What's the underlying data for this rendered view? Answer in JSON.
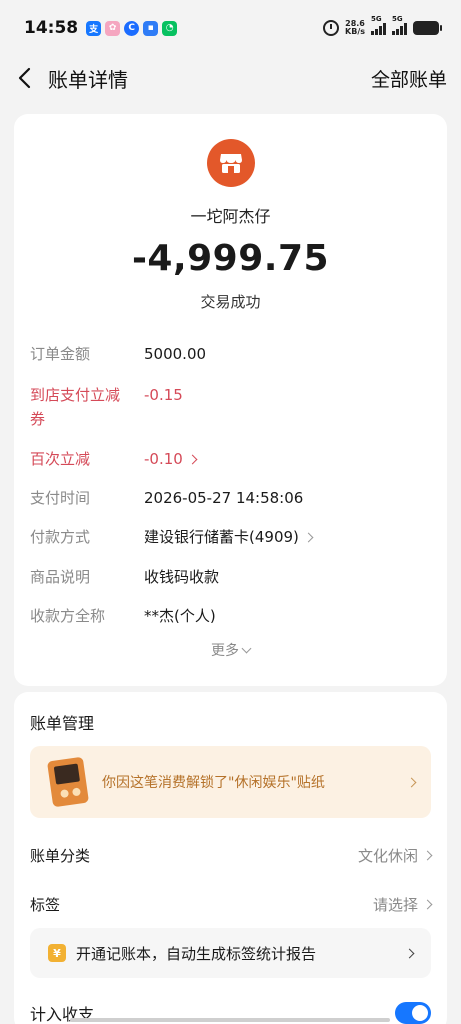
{
  "status_bar": {
    "time": "14:58",
    "net_speed_value": "28.6",
    "net_speed_unit": "KB/s",
    "signal1": "5G",
    "signal2": "5G",
    "apps": [
      {
        "name": "alipay-icon",
        "glyph": "支",
        "color": "#1677ff"
      },
      {
        "name": "pink-app-icon",
        "glyph": "✿",
        "color": "#f5a6c0"
      },
      {
        "name": "c-app-icon",
        "glyph": "C",
        "color": "#1b6cff"
      },
      {
        "name": "chat-app-icon",
        "glyph": "▪",
        "color": "#2f7cf6"
      },
      {
        "name": "wechat-icon",
        "glyph": "◔",
        "color": "#07c160"
      }
    ]
  },
  "nav": {
    "title": "账单详情",
    "right_action": "全部账单"
  },
  "detail": {
    "merchant_name": "一坨阿杰仔",
    "amount": "-4,999.75",
    "status": "交易成功",
    "rows": [
      {
        "label": "订单金额",
        "value": "5000.00"
      },
      {
        "label_line1": "到店支付立减",
        "label_line2": "券",
        "value": "-0.15"
      },
      {
        "label": "百次立减",
        "value": "-0.10"
      },
      {
        "label": "支付时间",
        "value": "2026-05-27 14:58:06"
      },
      {
        "label": "付款方式",
        "value": "建设银行储蓄卡(4909)"
      },
      {
        "label": "商品说明",
        "value": "收钱码收款"
      },
      {
        "label": "收款方全称",
        "value": "**杰(个人)"
      }
    ],
    "more_label": "更多"
  },
  "manage": {
    "title": "账单管理",
    "sticker_text": "你因这笔消费解锁了\"休闲娱乐\"贴纸",
    "category_label": "账单分类",
    "category_value": "文化休闲",
    "tag_label": "标签",
    "tag_value": "请选择",
    "ledger_icon": "¥",
    "ledger_text": "开通记账本，自动生成标签统计报告",
    "count_label": "计入收支",
    "count_enabled": true
  },
  "colors": {
    "accent": "#1677ff",
    "merchant": "#e3582a",
    "discount": "#d54a58",
    "sticker_text": "#b5722a"
  }
}
